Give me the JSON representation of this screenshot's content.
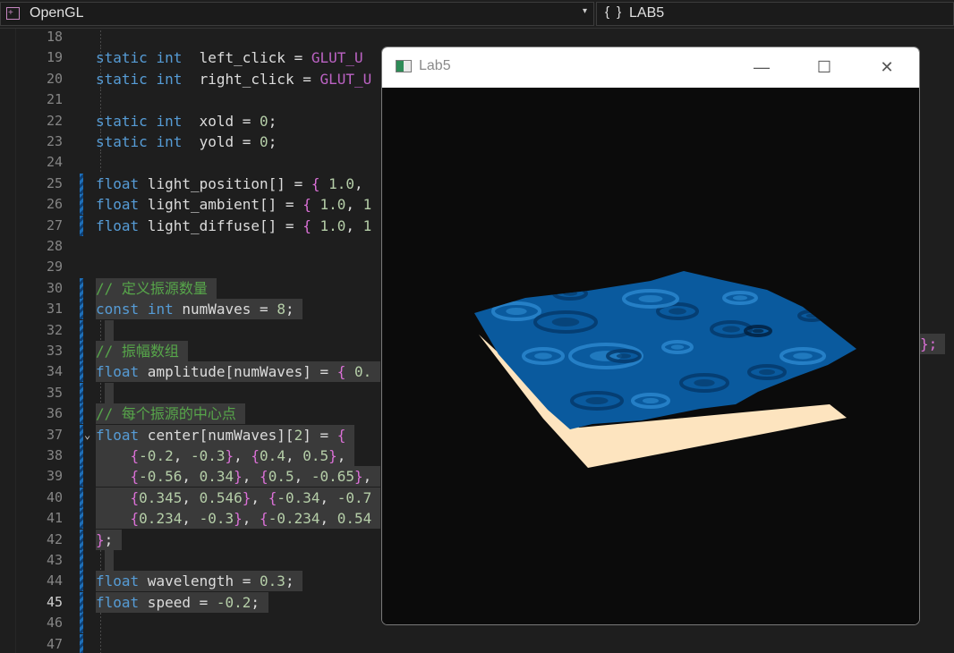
{
  "navbar": {
    "project": "OpenGL",
    "project_caret": "▾",
    "scope_icon": "{ }",
    "scope": "LAB5"
  },
  "editor": {
    "lines": [
      {
        "n": "18"
      },
      {
        "n": "19",
        "a": "static int  left_click = GLUT_U"
      },
      {
        "n": "20",
        "a": "static int  right_click = GLUT_U"
      },
      {
        "n": "21"
      },
      {
        "n": "22",
        "a": "static int  xold = 0;"
      },
      {
        "n": "23",
        "a": "static int  yold = 0;"
      },
      {
        "n": "24"
      },
      {
        "n": "25",
        "a": "float light_position[] = { 1.0,"
      },
      {
        "n": "26",
        "a": "float light_ambient[] = { 1.0, 1"
      },
      {
        "n": "27",
        "a": "float light_diffuse[] = { 1.0, 1"
      },
      {
        "n": "28"
      },
      {
        "n": "29"
      },
      {
        "n": "30",
        "a": "// 定义振源数量"
      },
      {
        "n": "31",
        "a": "const int numWaves = 8;"
      },
      {
        "n": "32"
      },
      {
        "n": "33",
        "a": "// 振幅数组"
      },
      {
        "n": "34",
        "a": "float amplitude[numWaves] = { 0.",
        "tail": "};"
      },
      {
        "n": "35"
      },
      {
        "n": "36",
        "a": "// 每个振源的中心点"
      },
      {
        "n": "37",
        "a": "float center[numWaves][2] = {"
      },
      {
        "n": "38",
        "a": "    {-0.2, -0.3}, {0.4, 0.5},"
      },
      {
        "n": "39",
        "a": "    {-0.56, 0.34}, {0.5, -0.65},"
      },
      {
        "n": "40",
        "a": "    {0.345, 0.546}, {-0.34, -0.7"
      },
      {
        "n": "41",
        "a": "    {0.234, -0.3}, {-0.234, 0.54"
      },
      {
        "n": "42",
        "a": "};"
      },
      {
        "n": "43"
      },
      {
        "n": "44",
        "a": "float wavelength = 0.3;"
      },
      {
        "n": "45",
        "a": "float speed = -0.2;"
      },
      {
        "n": "46"
      },
      {
        "n": "47"
      }
    ]
  },
  "window": {
    "title": "Lab5",
    "minimize_glyph": "—",
    "maximize_glyph": "☐",
    "close_glyph": "✕",
    "colors": {
      "background": "#0b0b0b",
      "water_dark": "#053a6b",
      "water_mid": "#0a5a9e",
      "water_light": "#2a86cc",
      "sand": "#fde4bf"
    }
  },
  "colors": {
    "keyword": "#569cd6",
    "comment": "#57a64a",
    "number": "#b5cea8",
    "brace": "#da70d6",
    "macro": "#bd63c5",
    "change_bar": "#1e6fb8"
  }
}
